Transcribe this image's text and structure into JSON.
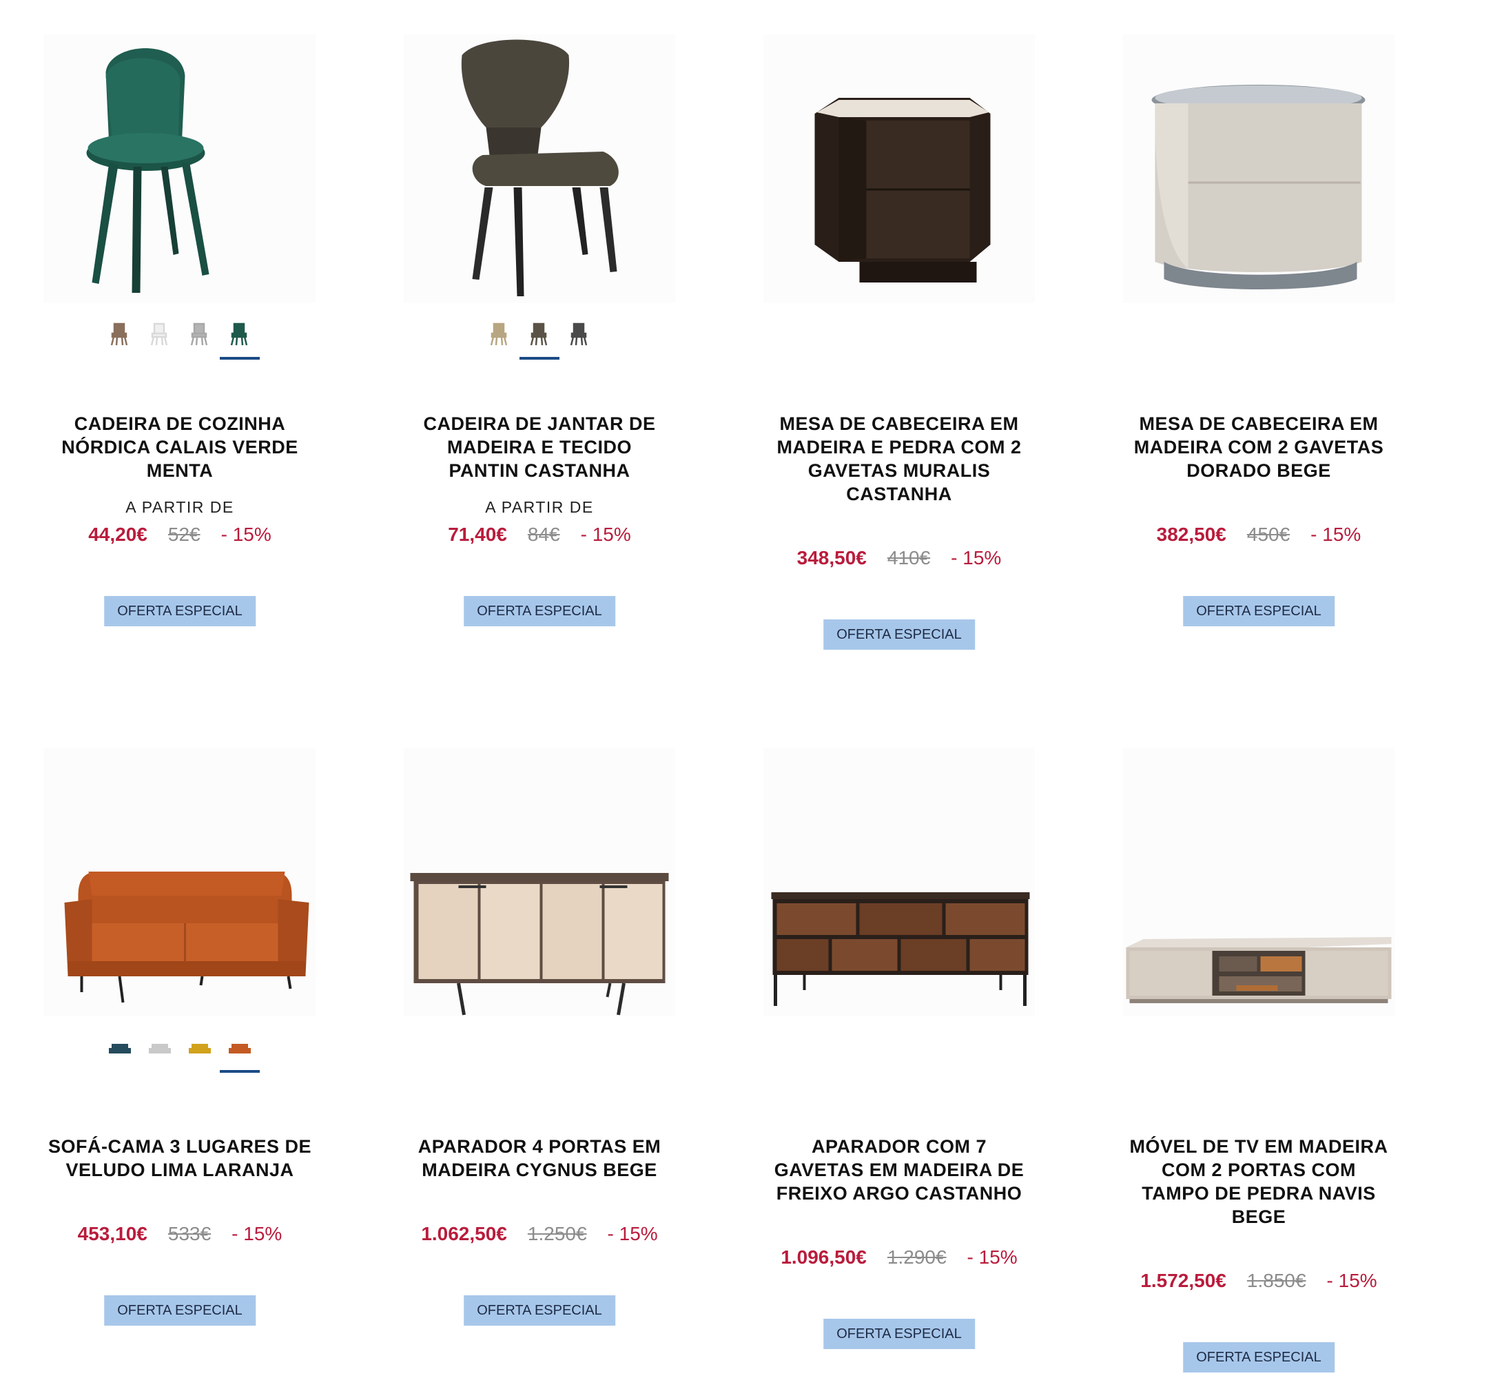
{
  "products": [
    {
      "title_lines": [
        "CADEIRA DE COZINHA",
        "NÓRDICA CALAIS VERDE",
        "MENTA"
      ],
      "from_label": "A PARTIR DE",
      "price": "44,20€",
      "old_price": "52€",
      "discount": "- 15%",
      "badge": "OFERTA ESPECIAL",
      "image": "green-chair",
      "swatches": [
        {
          "color": "#8a6f5c",
          "icon": "chair-swatch"
        },
        {
          "color": "#eeeeee",
          "icon": "chair-swatch"
        },
        {
          "color": "#a8a8a8",
          "icon": "chair-swatch"
        },
        {
          "color": "#1f5a4c",
          "icon": "chair-swatch"
        }
      ],
      "active_swatch": 3
    },
    {
      "title_lines": [
        "CADEIRA DE JANTAR DE",
        "MADEIRA E TECIDO",
        "PANTIN CASTANHA"
      ],
      "from_label": "A PARTIR DE",
      "price": "71,40€",
      "old_price": "84€",
      "discount": "- 15%",
      "badge": "OFERTA ESPECIAL",
      "image": "brown-chair",
      "swatches": [
        {
          "color": "#b8a682",
          "icon": "chair-swatch"
        },
        {
          "color": "#5b5346",
          "icon": "chair-swatch"
        },
        {
          "color": "#4a4a4a",
          "icon": "chair-swatch"
        }
      ],
      "active_swatch": 1
    },
    {
      "title_lines": [
        "MESA DE CABECEIRA EM",
        "MADEIRA E PEDRA COM 2",
        "GAVETAS MURALIS",
        "CASTANHA"
      ],
      "from_label": "",
      "price": "348,50€",
      "old_price": "410€",
      "discount": "- 15%",
      "badge": "OFERTA ESPECIAL",
      "image": "dark-nightstand",
      "swatches": []
    },
    {
      "title_lines": [
        "MESA DE CABECEIRA EM",
        "MADEIRA COM 2 GAVETAS",
        "DORADO BEGE"
      ],
      "from_label": "",
      "price": "382,50€",
      "old_price": "450€",
      "discount": "- 15%",
      "badge": "OFERTA ESPECIAL",
      "image": "beige-nightstand",
      "swatches": []
    },
    {
      "title_lines": [
        "SOFÁ-CAMA 3 LUGARES DE",
        "VELUDO LIMA LARANJA"
      ],
      "from_label": "",
      "price": "453,10€",
      "old_price": "533€",
      "discount": "- 15%",
      "badge": "OFERTA ESPECIAL",
      "image": "orange-sofa",
      "swatches": [
        {
          "color": "#254b5e",
          "icon": "sofa-swatch"
        },
        {
          "color": "#c9c9c9",
          "icon": "sofa-swatch"
        },
        {
          "color": "#d2a21d",
          "icon": "sofa-swatch"
        },
        {
          "color": "#c45a24",
          "icon": "sofa-swatch"
        }
      ],
      "active_swatch": 3
    },
    {
      "title_lines": [
        "APARADOR 4 PORTAS EM",
        "MADEIRA CYGNUS BEGE"
      ],
      "from_label": "",
      "price": "1.062,50€",
      "old_price": "1.250€",
      "discount": "- 15%",
      "badge": "OFERTA ESPECIAL",
      "image": "beige-sideboard",
      "swatches": []
    },
    {
      "title_lines": [
        "APARADOR COM 7",
        "GAVETAS EM MADEIRA DE",
        "FREIXO ARGO CASTANHO"
      ],
      "from_label": "",
      "price": "1.096,50€",
      "old_price": "1.290€",
      "discount": "- 15%",
      "badge": "OFERTA ESPECIAL",
      "image": "brown-sideboard",
      "swatches": []
    },
    {
      "title_lines": [
        "MÓVEL DE TV EM MADEIRA",
        "COM 2 PORTAS COM",
        "TAMPO DE PEDRA NAVIS",
        "BEGE"
      ],
      "from_label": "",
      "price": "1.572,50€",
      "old_price": "1.850€",
      "discount": "- 15%",
      "badge": "OFERTA ESPECIAL",
      "image": "tv-unit",
      "swatches": []
    }
  ]
}
